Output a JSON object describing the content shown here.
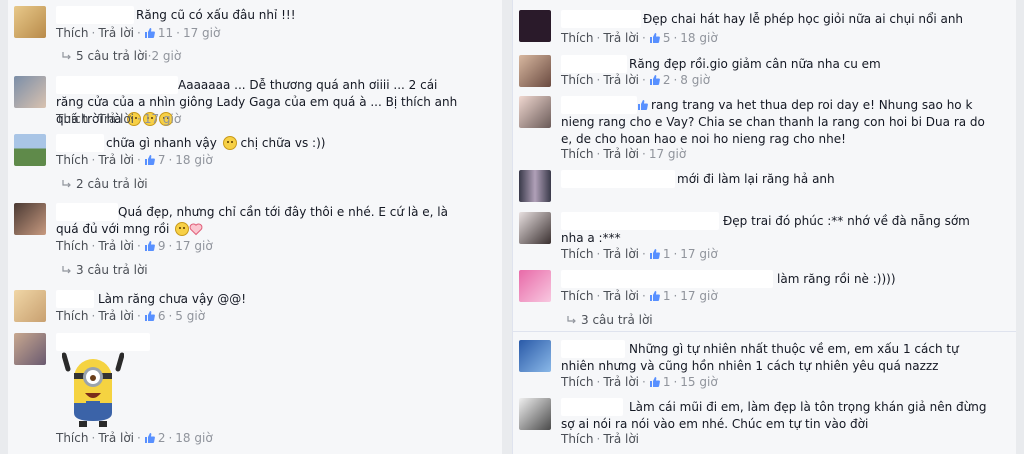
{
  "labels": {
    "like": "Thích",
    "reply": "Trả lời"
  },
  "colors": {
    "link": "#4b4f56",
    "meta": "#90949c",
    "like_blue": "#5890ff"
  },
  "left": [
    {
      "text": "Răng cũ có xấu đâu nhỉ !!!",
      "likes": "11",
      "time": "17 giờ",
      "replies": "5 câu trả lời",
      "replies_time": "2 giờ"
    },
    {
      "text": "Aaaaaaa ... Dễ thương quá anh ơiiii ... 2 cái răng cửa của a nhìn giông Lady Gaga của em quá à ... Bị thích anh quá trời hà",
      "likes": "",
      "time": "17 giờ"
    },
    {
      "text": "chữa gì nhanh vậy",
      "text2": "chị chữa vs :))",
      "likes": "7",
      "time": "18 giờ",
      "replies": "2 câu trả lời"
    },
    {
      "text": "Quá đẹp, nhưng chỉ cần tới đây thôi e nhé. E cứ là e, là quá đủ với mng rồi",
      "likes": "9",
      "time": "17 giờ",
      "replies": "3 câu trả lời"
    },
    {
      "text": "Làm răng chưa vậy @@!",
      "likes": "6",
      "time": "5 giờ"
    },
    {
      "text": "",
      "likes": "2",
      "time": "18 giờ",
      "sticker": "minion-sticker"
    }
  ],
  "right": [
    {
      "text": "Đẹp chai hát hay lễ phép học giỏi nữa ai chụi nổi anh",
      "likes": "5",
      "time": "18 giờ"
    },
    {
      "text": "Răng đẹp rồi.gio giảm cân nữa nha cu em",
      "likes": "2",
      "time": "8 giờ"
    },
    {
      "text": "rang trang va het thua dep roi day e! Nhung sao ho k nieng rang cho e Vay? Chia se chan thanh la rang con hoi bi Dua ra do e, de cho hoan hao e noi ho nieng rag cho nhe!",
      "likes": "",
      "time": "17 giờ"
    },
    {
      "text": "mới đi làm lại răng hả anh",
      "likes": "",
      "time": ""
    },
    {
      "text": "Đẹp trai đó phúc :** nhớ về đà nẵng sớm nha a :***",
      "likes": "1",
      "time": "17 giờ"
    },
    {
      "text": "làm răng rồi nè :))))",
      "likes": "1",
      "time": "17 giờ",
      "replies": "3 câu trả lời"
    },
    {
      "text": "Những gì tự nhiên nhất thuộc về em, em xấu 1 cách tự nhiên nhưng và cũng hồn nhiên 1 cách tự nhiên yêu quá nazzz",
      "likes": "1",
      "time": "15 giờ"
    },
    {
      "text": "Làm cái mũi đi em, làm đẹp là tôn trọng khán giả nên đừng sợ ai nói ra nói vào em nhé. Chúc em tự tin vào đời",
      "likes": "",
      "time": ""
    }
  ]
}
